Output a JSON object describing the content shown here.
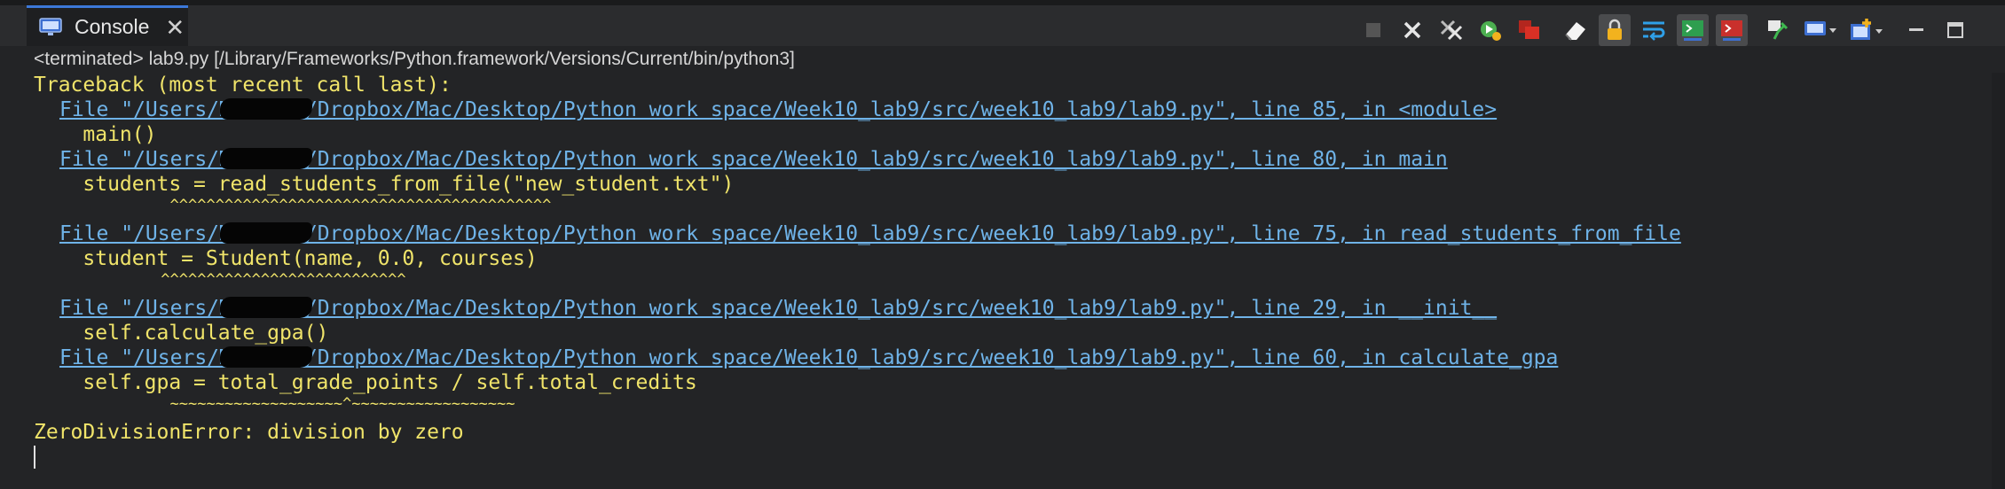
{
  "tab": {
    "label": "Console",
    "close_glyph": "✕"
  },
  "toolbar": {
    "icons": [
      "terminate-icon",
      "remove-launch-icon",
      "remove-all-terminated-icon",
      "debug-relaunch-icon",
      "stop-red-icon",
      "clear-console-icon",
      "scroll-lock-icon",
      "word-wrap-icon",
      "show-stdout-icon",
      "show-stderr-icon",
      "pin-console-icon",
      "display-console-icon",
      "open-console-icon",
      "minimize-icon",
      "maximize-icon"
    ]
  },
  "status": "<terminated> lab9.py [/Library/Frameworks/Python.framework/Versions/Current/bin/python3]",
  "console": {
    "traceback_header": "Traceback (most recent call last):",
    "frames": [
      {
        "file_link": "File \"/Users/M     a/Dropbox/Mac/Desktop/Python work space/Week10_lab9/src/week10_lab9/lab9.py\", line 85, in <module>",
        "code": "    main()",
        "marker": ""
      },
      {
        "file_link": "File \"/Users/M     a/Dropbox/Mac/Desktop/Python work space/Week10_lab9/src/week10_lab9/lab9.py\", line 80, in main",
        "code": "    students = read_students_from_file(\"new_student.txt\")",
        "marker": "               ^^^^^^^^^^^^^^^^^^^^^^^^^^^^^^^^^^^^^^^^^^"
      },
      {
        "file_link": "File \"/Users/M     a/Dropbox/Mac/Desktop/Python work space/Week10_lab9/src/week10_lab9/lab9.py\", line 75, in read_students_from_file",
        "code": "    student = Student(name, 0.0, courses)",
        "marker": "              ^^^^^^^^^^^^^^^^^^^^^^^^^^^"
      },
      {
        "file_link": "File \"/Users/M     a/Dropbox/Mac/Desktop/Python work space/Week10_lab9/src/week10_lab9/lab9.py\", line 29, in __init__",
        "code": "    self.calculate_gpa()",
        "marker": ""
      },
      {
        "file_link": "File \"/Users/M     a/Dropbox/Mac/Desktop/Python work space/Week10_lab9/src/week10_lab9/lab9.py\", line 60, in calculate_gpa",
        "code": "    self.gpa = total_grade_points / self.total_credits",
        "marker": "               ~~~~~~~~~~~~~~~~~~~^~~~~~~~~~~~~~~~~~~"
      }
    ],
    "error": "ZeroDivisionError: division by zero"
  }
}
